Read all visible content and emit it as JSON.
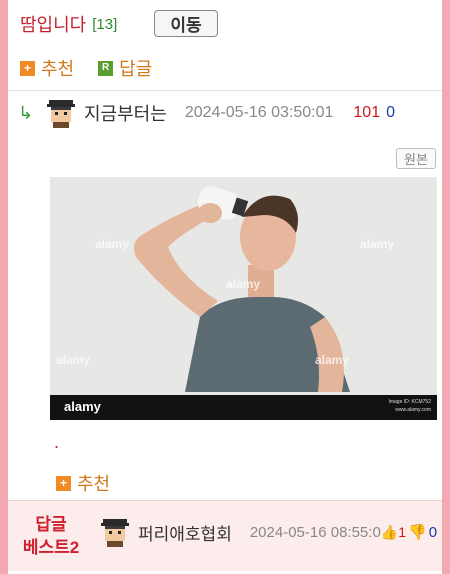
{
  "header": {
    "title": "땀입니다",
    "count": "[13]",
    "move_label": "이동"
  },
  "actions": {
    "recommend_label": "추천",
    "reply_label": "답글",
    "reply_icon_letter": "R"
  },
  "comment": {
    "reply_arrow": "↳",
    "nickname": "지금부터는",
    "date": "2024-05-16 03:50:01",
    "upvotes": "101",
    "downvotes": "0",
    "original_label": "원본",
    "body_text": ".",
    "recommend_label": "추천",
    "image": {
      "watermark": "alamy",
      "image_id": "Image ID: KCM752",
      "site": "www.alamy.com"
    }
  },
  "best": {
    "label_line1": "답글",
    "label_line2": "베스트2",
    "nickname": "퍼리애호협회",
    "date": "2024-05-16 08:55:0",
    "upvotes": "1",
    "downvotes": "0"
  },
  "colors": {
    "side_bg": "#f4a9b2",
    "accent_red": "#c8202e",
    "green": "#2f8a2f",
    "orange": "#f08a24"
  }
}
